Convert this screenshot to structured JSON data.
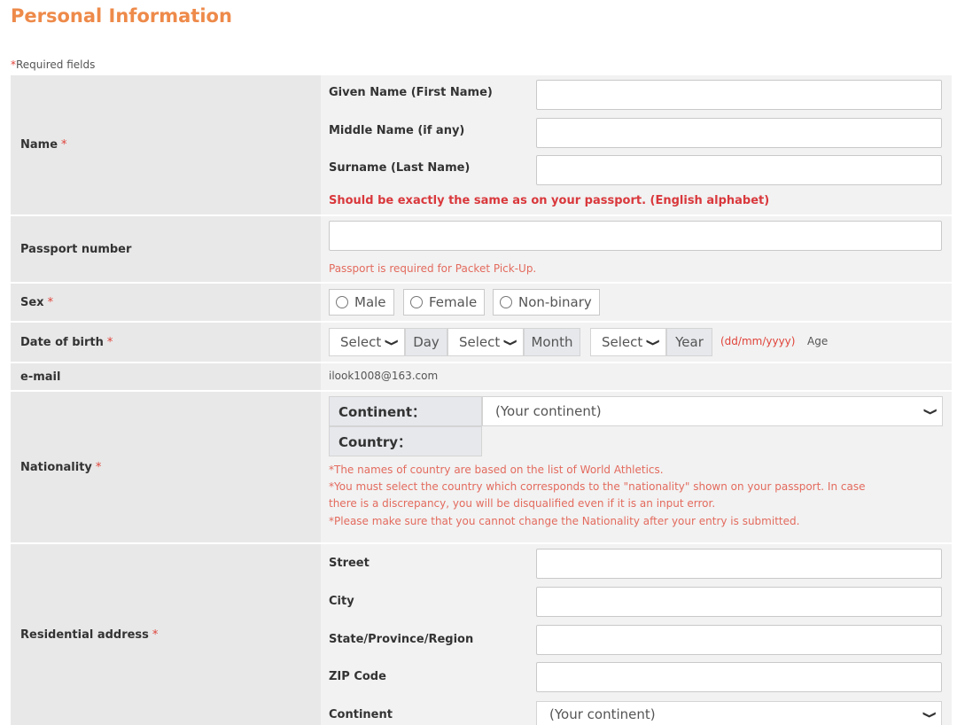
{
  "page": {
    "title": "Personal Information",
    "required_star": "*",
    "required_note": "Required fields"
  },
  "name_row": {
    "label": "Name",
    "star": "*",
    "fields": [
      {
        "label": "Given Name (First Name)",
        "value": ""
      },
      {
        "label": "Middle Name (if any)",
        "value": ""
      },
      {
        "label": "Surname (Last Name)",
        "value": ""
      }
    ],
    "note": "Should be exactly the same as on your passport. (English alphabet)"
  },
  "passport_row": {
    "label": "Passport number",
    "value": "",
    "note": "Passport is required for Packet Pick-Up."
  },
  "sex_row": {
    "label": "Sex",
    "star": "*",
    "options": [
      "Male",
      "Female",
      "Non-binary"
    ]
  },
  "dob_row": {
    "label": "Date of birth",
    "star": "*",
    "day_select": "Select",
    "day_addon": "Day",
    "month_select": "Select",
    "month_addon": "Month",
    "year_select": "Select",
    "year_addon": "Year",
    "format_hint": "(dd/mm/yyyy)",
    "age_label": "Age"
  },
  "email_row": {
    "label": "e-mail",
    "value": "ilook1008@163.com"
  },
  "nationality_row": {
    "label": "Nationality",
    "star": "*",
    "continent_label": "Continent：",
    "continent_value": "(Your continent)",
    "country_label": "Country：",
    "notes": [
      "*The names of country are based on the list of World Athletics.",
      "*You must select the country which corresponds to the \"nationality\" shown on your passport. In case",
      "there is a discrepancy, you will be disqualified even if it is an input error.",
      "*Please make sure that you cannot change the Nationality after your entry is submitted."
    ]
  },
  "address_row": {
    "label": "Residential address",
    "star": "*",
    "fields": [
      {
        "label": "Street",
        "value": ""
      },
      {
        "label": "City",
        "value": ""
      },
      {
        "label": "State/Province/Region",
        "value": ""
      },
      {
        "label": "ZIP Code",
        "value": ""
      }
    ],
    "continent_label": "Continent",
    "continent_value": "(Your continent)"
  },
  "icons": {
    "dropdown": "chevron-down-icon",
    "radio": "radio-circle-icon"
  },
  "colors": {
    "title": "#ee8a4a",
    "required": "#e0433a",
    "label_bg": "#e8e8e8",
    "content_bg": "#f2f2f2"
  }
}
